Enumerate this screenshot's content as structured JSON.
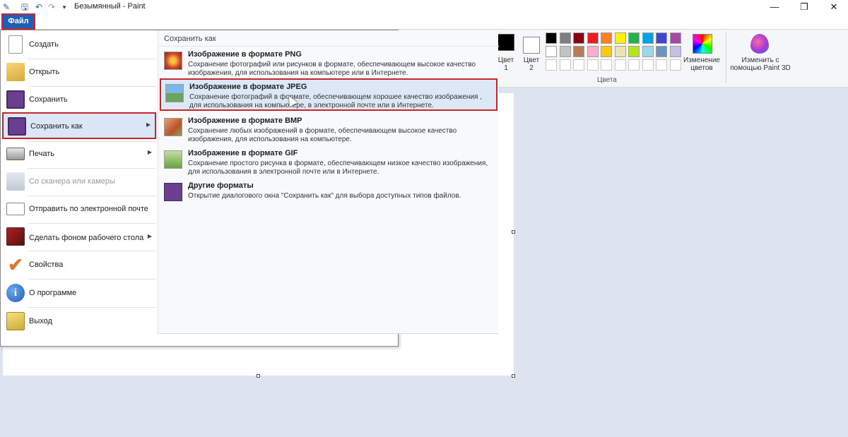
{
  "window": {
    "title": "Безымянный - Paint",
    "minimize": "—",
    "restore": "❐",
    "close": "✕"
  },
  "quick_access": {
    "save_icon": "save-icon",
    "undo_icon": "undo-icon",
    "redo_icon": "redo-icon",
    "customize_icon": "dropdown-icon"
  },
  "file_tab": {
    "label": "Файл"
  },
  "ribbon": {
    "color1_label_line1": "Цвет",
    "color1_label_line2": "1",
    "color2_label_line1": "Цвет",
    "color2_label_line2": "2",
    "edit_colors_line1": "Изменение",
    "edit_colors_line2": "цветов",
    "paint3d_line1": "Изменить с",
    "paint3d_line2": "помощью Paint 3D",
    "group_label": "Цвета",
    "color1": "#000000",
    "color2": "#ffffff",
    "palette_row1": [
      "#000000",
      "#7f7f7f",
      "#880015",
      "#ed1c24",
      "#ff7f27",
      "#fff200",
      "#22b14c",
      "#00a2e8",
      "#3f48cc",
      "#a349a4"
    ],
    "palette_row2": [
      "#ffffff",
      "#c3c3c3",
      "#b97a57",
      "#ffaec9",
      "#ffc90e",
      "#efe4b0",
      "#b5e61d",
      "#99d9ea",
      "#7092be",
      "#c8bfe7"
    ]
  },
  "file_menu": {
    "items": [
      {
        "label": "Создать",
        "icon": "new-file-icon"
      },
      {
        "label": "Открыть",
        "icon": "open-folder-icon"
      },
      {
        "label": "Сохранить",
        "icon": "save-icon"
      },
      {
        "label": "Сохранить как",
        "icon": "save-as-icon"
      },
      {
        "label": "Печать",
        "icon": "printer-icon"
      },
      {
        "label": "Со сканера или камеры",
        "icon": "scanner-icon"
      },
      {
        "label": "Отправить по электронной почте",
        "icon": "email-icon"
      },
      {
        "label": "Сделать фоном рабочего стола",
        "icon": "desktop-background-icon"
      },
      {
        "label": "Свойства",
        "icon": "checkmark-icon"
      },
      {
        "label": "О программе",
        "icon": "info-icon"
      },
      {
        "label": "Выход",
        "icon": "exit-icon"
      }
    ],
    "submenu": {
      "header": "Сохранить как",
      "items": [
        {
          "title": "Изображение в формате PNG",
          "desc": "Сохранение фотографий или рисунков в формате, обеспечивающем высокое качество изображения, для использования на компьютере или в Интернете."
        },
        {
          "title": "Изображение в формате JPEG",
          "desc": "Сохранение фотографий в формате, обеспечивающем хорошее качество изображения , для использования на компьютере, в электронной почте или в Интернете."
        },
        {
          "title": "Изображение в формате BMP",
          "desc": "Сохранение любых изображений в формате, обеспечивающем высокое качество изображения, для использования на компьютере."
        },
        {
          "title": "Изображение в формате GIF",
          "desc": "Сохранение простого рисунка в формате, обеспечивающем низкое качество изображения, для использования в электронной почте или в Интернете."
        },
        {
          "title": "Другие форматы",
          "desc": "Открытие диалогового окна \"Сохранить как\" для выбора доступных типов файлов."
        }
      ]
    }
  }
}
